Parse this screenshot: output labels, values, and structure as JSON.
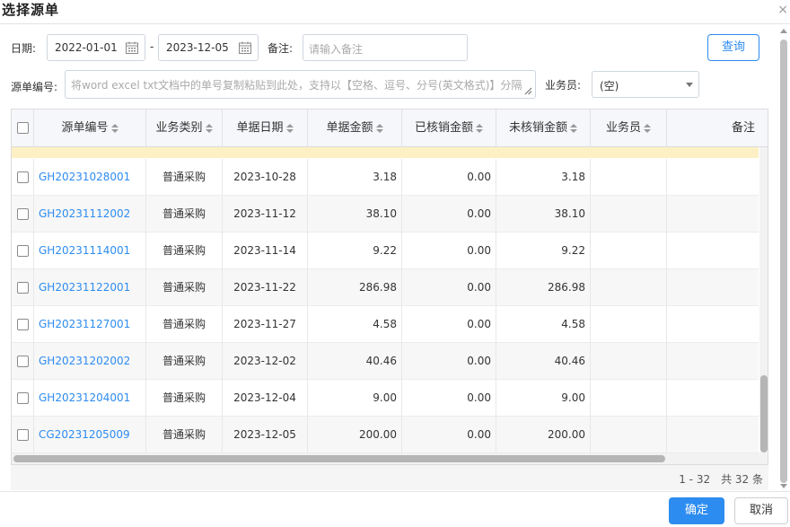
{
  "dialog": {
    "title": "选择源单",
    "close_label": "×"
  },
  "filters": {
    "date_label": "日期:",
    "date_from": "2022-01-01",
    "date_sep": "-",
    "date_to": "2023-12-05",
    "note_label": "备注:",
    "note_placeholder": "请输入备注",
    "source_no_label": "源单编号:",
    "source_no_placeholder": "将word excel txt文档中的单号复制粘贴到此处，支持以【空格、逗号、分号(英文格式)】分隔",
    "salesperson_label": "业务员:",
    "salesperson_value": "(空)",
    "query_button": "查询"
  },
  "table": {
    "columns": [
      "源单编号",
      "业务类别",
      "单据日期",
      "单据金额",
      "已核销金额",
      "未核销金额",
      "业务员",
      "备注"
    ],
    "rows": [
      {
        "no": "GH20231028001",
        "category": "普通采购",
        "date": "2023-10-28",
        "amount": "3.18",
        "written_off": "0.00",
        "outstanding": "3.18",
        "salesperson": ""
      },
      {
        "no": "GH20231112002",
        "category": "普通采购",
        "date": "2023-11-12",
        "amount": "38.10",
        "written_off": "0.00",
        "outstanding": "38.10",
        "salesperson": ""
      },
      {
        "no": "GH20231114001",
        "category": "普通采购",
        "date": "2023-11-14",
        "amount": "9.22",
        "written_off": "0.00",
        "outstanding": "9.22",
        "salesperson": ""
      },
      {
        "no": "GH20231122001",
        "category": "普通采购",
        "date": "2023-11-22",
        "amount": "286.98",
        "written_off": "0.00",
        "outstanding": "286.98",
        "salesperson": ""
      },
      {
        "no": "GH20231127001",
        "category": "普通采购",
        "date": "2023-11-27",
        "amount": "4.58",
        "written_off": "0.00",
        "outstanding": "4.58",
        "salesperson": ""
      },
      {
        "no": "GH20231202002",
        "category": "普通采购",
        "date": "2023-12-02",
        "amount": "40.46",
        "written_off": "0.00",
        "outstanding": "40.46",
        "salesperson": ""
      },
      {
        "no": "GH20231204001",
        "category": "普通采购",
        "date": "2023-12-04",
        "amount": "9.00",
        "written_off": "0.00",
        "outstanding": "9.00",
        "salesperson": ""
      },
      {
        "no": "CG20231205009",
        "category": "普通采购",
        "date": "2023-12-05",
        "amount": "200.00",
        "written_off": "0.00",
        "outstanding": "200.00",
        "salesperson": ""
      }
    ]
  },
  "pager": {
    "info": "1 - 32　共 32 条"
  },
  "footer": {
    "ok_button": "确定",
    "cancel_button": "取消"
  },
  "colors": {
    "accent": "#2d8cf0",
    "highlight_row": "#fdf0c4"
  }
}
